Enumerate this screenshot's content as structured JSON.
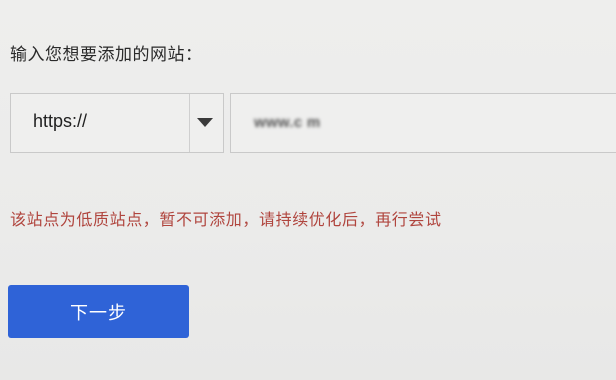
{
  "form": {
    "prompt_label": "输入您想要添加的网站：",
    "protocol_select": {
      "selected": "https://"
    },
    "domain_input": {
      "value": "",
      "blurred_text": "www.c    m"
    },
    "error_message": "该站点为低质站点，暂不可添加，请持续优化后，再行尝试",
    "next_button_label": "下一步"
  },
  "colors": {
    "page_background": "#ebebea",
    "error_text": "#b0453e",
    "primary_button": "#2f63d7",
    "field_border": "#c9c9c9"
  },
  "icons": {
    "protocol_dropdown": "chevron-down-icon"
  }
}
